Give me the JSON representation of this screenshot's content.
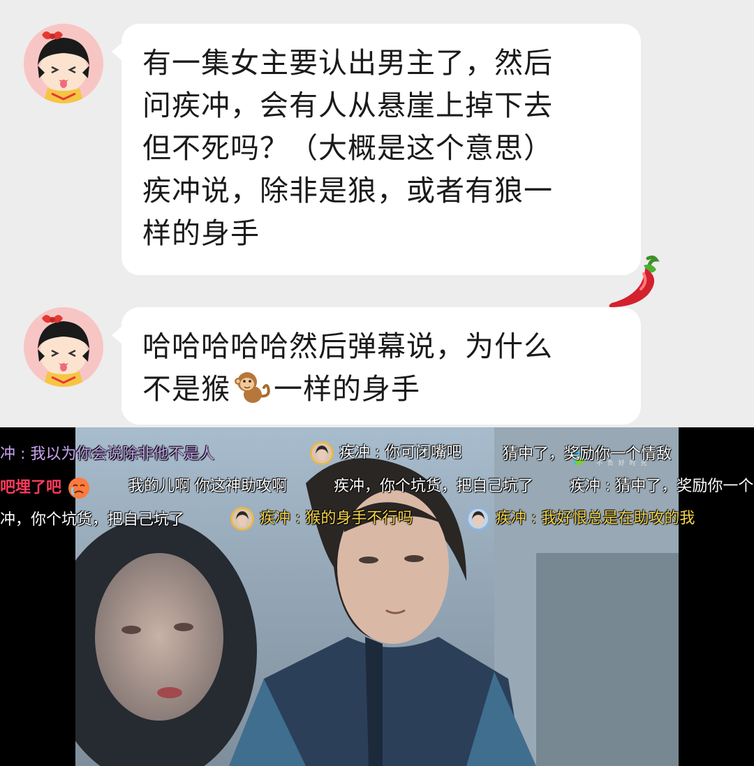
{
  "messages": [
    {
      "lines": [
        "有一集女主要认出男主了，然后",
        "问疾冲，会有人从悬崖上掉下去",
        "但不死吗？（大概是这个意思）",
        "疾冲说，除非是狼，或者有狼一",
        "样的身手"
      ],
      "reaction": "chili-pepper-icon"
    },
    {
      "line1": "哈哈哈哈哈然后弹幕说，为什么",
      "line2_before": "不是猴",
      "line2_emoji": "monkey-emoji",
      "line2_after": "一样的身手"
    }
  ],
  "video": {
    "watermark_sub": "不 负 好 时 光",
    "danmaku": [
      {
        "text": "冲 : 我以为你会说除非他不是人",
        "color": "#c9a4f0"
      },
      {
        "text": "疾冲 : 你可闭嘴吧",
        "color": "#ffffff",
        "avatar": "gold"
      },
      {
        "text": "猜中了，奖励你一个情敌",
        "color": "#ffffff"
      },
      {
        "text": "吧埋了吧",
        "color": "#ff3b5c"
      },
      {
        "text": "我的儿啊 你这神助攻啊",
        "color": "#ffffff"
      },
      {
        "text": "疾冲，你个坑货，把自己坑了",
        "color": "#ffffff"
      },
      {
        "text": "疾冲 : 猜中了，奖励你一个",
        "color": "#ffffff"
      },
      {
        "text": "冲，你个坑货，把自己坑了",
        "color": "#ffffff"
      },
      {
        "text": "疾冲 : 猴的身手不行吗",
        "color": "#f5d44a",
        "avatar": "gold"
      },
      {
        "text": "疾冲 : 我好恨总是在助攻的我",
        "color": "#f5d44a",
        "avatar": "blue"
      }
    ]
  },
  "colors": {
    "chat_bg": "#ededed",
    "bubble_bg": "#ffffff",
    "avatar_bg": "#f7c6c4"
  }
}
